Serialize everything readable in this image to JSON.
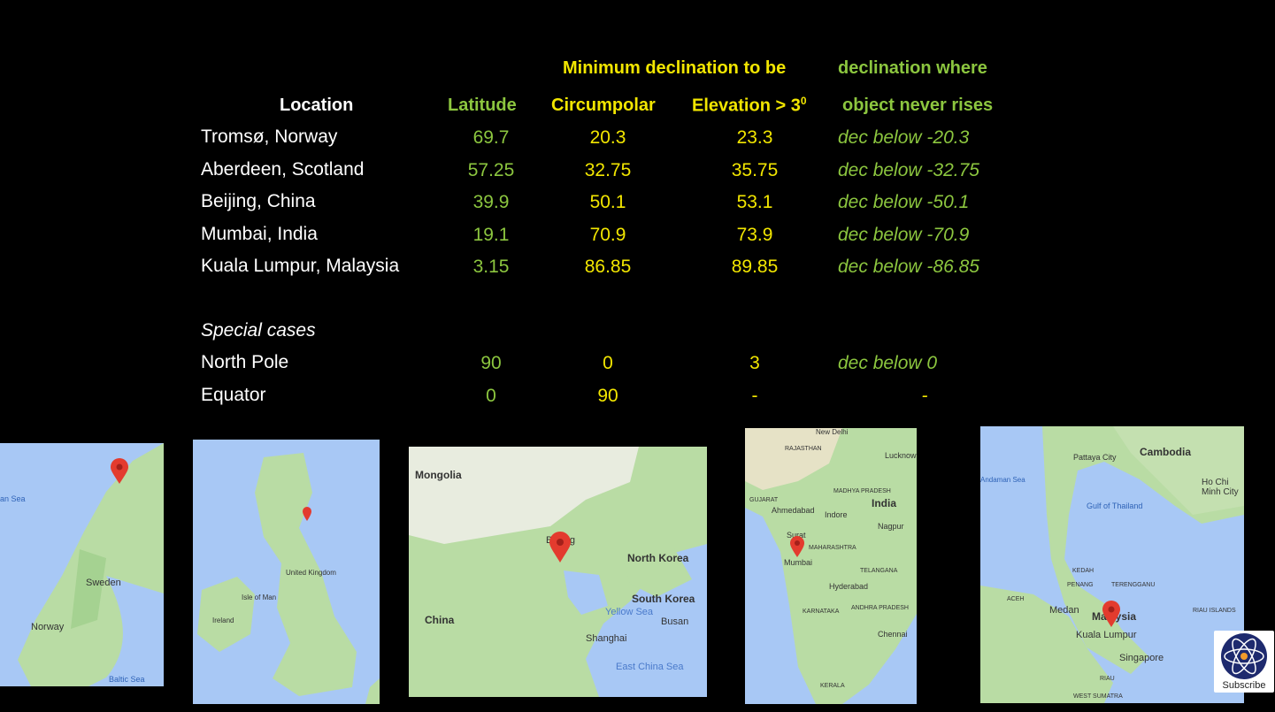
{
  "headers": {
    "top_center": "Minimum declination  to be",
    "top_right": "declination where",
    "location": "Location",
    "latitude": "Latitude",
    "circumpolar": "Circumpolar",
    "elevation": "Elevation > 3",
    "elevation_sup": "0",
    "never_rises": "object never  rises"
  },
  "rows": [
    {
      "location": "Tromsø, Norway",
      "latitude": "69.7",
      "circumpolar": "20.3",
      "elevation": "23.3",
      "never": "dec below -20.3"
    },
    {
      "location": "Aberdeen, Scotland",
      "latitude": "57.25",
      "circumpolar": "32.75",
      "elevation": "35.75",
      "never": "dec below -32.75"
    },
    {
      "location": "Beijing, China",
      "latitude": "39.9",
      "circumpolar": "50.1",
      "elevation": "53.1",
      "never": "dec below -50.1"
    },
    {
      "location": "Mumbai, India",
      "latitude": "19.1",
      "circumpolar": "70.9",
      "elevation": "73.9",
      "never": "dec below -70.9"
    },
    {
      "location": "Kuala Lumpur, Malaysia",
      "latitude": "3.15",
      "circumpolar": "86.85",
      "elevation": "89.85",
      "never": "dec below -86.85"
    }
  ],
  "special_title": "Special cases",
  "special_rows": [
    {
      "location": "North Pole",
      "latitude": "90",
      "circumpolar": "0",
      "elevation": "3",
      "never": "dec below 0"
    },
    {
      "location": "Equator",
      "latitude": "0",
      "circumpolar": "90",
      "elevation": "-",
      "never": "-"
    }
  ],
  "maps": {
    "norway": {
      "labels": [
        "Sweden",
        "Norway",
        "Baltic Sea",
        "an Sea"
      ]
    },
    "uk": {
      "labels": [
        "United Kingdom",
        "Ireland",
        "Isle of Man"
      ]
    },
    "china": {
      "labels": [
        "Mongolia",
        "China",
        "North Korea",
        "South Korea",
        "Yellow Sea",
        "Busan",
        "Shanghai",
        "East China Sea",
        "Beijing"
      ]
    },
    "india": {
      "labels": [
        "New Delhi",
        "RAJASTHAN",
        "GUJARAT",
        "Ahmedabad",
        "MADHYA PRADESH",
        "Indore",
        "India",
        "Lucknow",
        "Nagpur",
        "Surat",
        "Mumbai",
        "MAHARASHTRA",
        "TELANGANA",
        "Hyderabad",
        "KARNATAKA",
        "ANDHRA PRADESH",
        "Chennai",
        "KERALA"
      ]
    },
    "malaysia": {
      "labels": [
        "Cambodia",
        "Pattaya City",
        "Andaman Sea",
        "Ho Chi Minh City",
        "Gulf of Thailand",
        "KEDAH",
        "PENANG",
        "TERENGGANU",
        "ACEH",
        "Medan",
        "Malaysia",
        "Kuala Lumpur",
        "Singapore",
        "RIAU ISLANDS",
        "RIAU",
        "WEST SUMATRA"
      ]
    }
  },
  "badge": {
    "label": "Subscribe"
  },
  "colors": {
    "yellow": "#f2e600",
    "green": "#8cc63f",
    "white": "#ffffff",
    "background": "#000000",
    "water": "#a8c8f5",
    "land": "#b9dca4"
  }
}
